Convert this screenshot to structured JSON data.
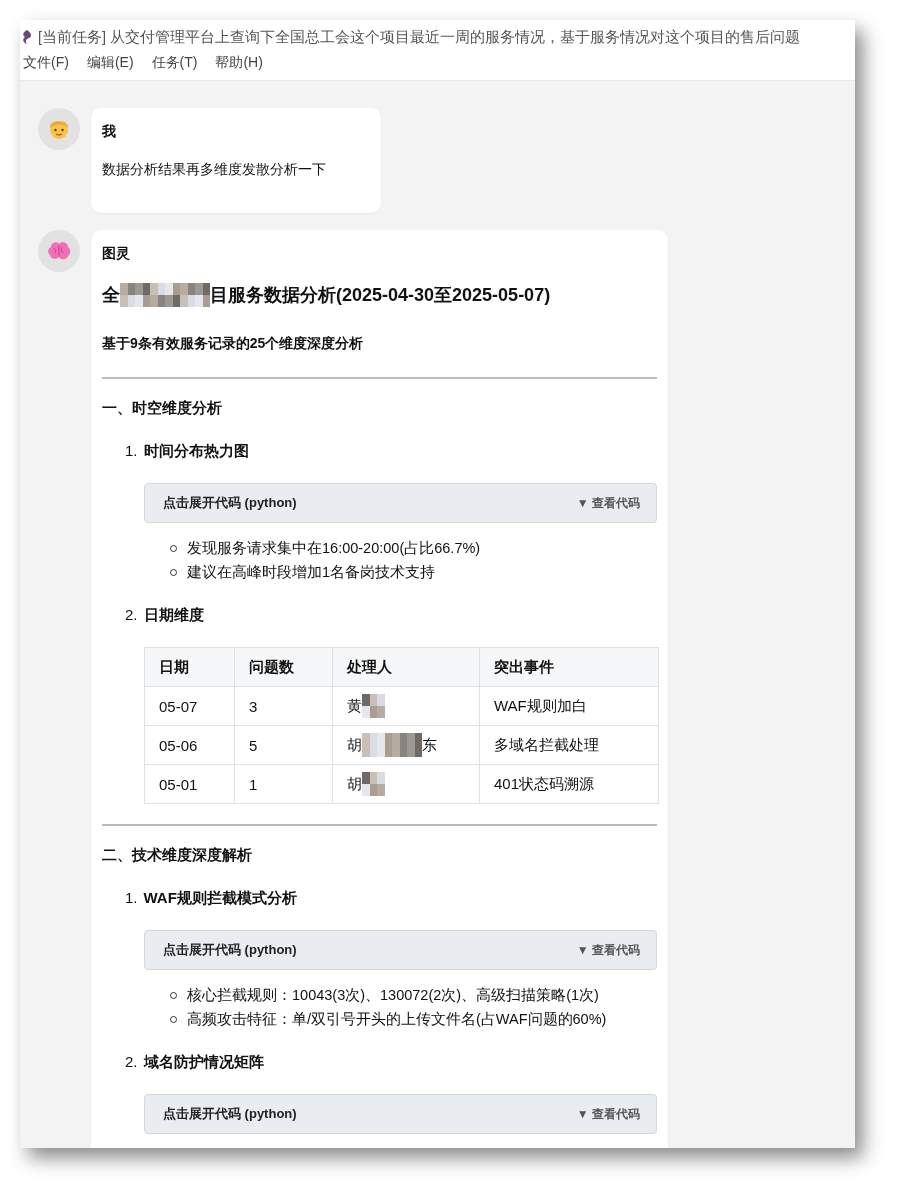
{
  "window": {
    "title": "[当前任务] 从交付管理平台上查询下全国总工会这个项目最近一周的服务情况，基于服务情况对这个项目的售后问题"
  },
  "menu": [
    "文件(F)",
    "编辑(E)",
    "任务(T)",
    "帮助(H)"
  ],
  "messages": [
    {
      "kind": "user",
      "sender": "我",
      "text": "数据分析结果再多维度发散分析一下"
    },
    {
      "kind": "assistant",
      "sender": "图灵",
      "blocks": [
        {
          "kind": "title",
          "segments": [
            {
              "kind": "text",
              "text": "全"
            },
            {
              "kind": "redacted_long"
            },
            {
              "kind": "text",
              "text": "目服务数据分析(2025-04-30至2025-05-07)"
            }
          ]
        },
        {
          "kind": "subtitle",
          "text": "基于9条有效服务记录的25个维度深度分析"
        },
        {
          "kind": "rule"
        },
        {
          "kind": "heading",
          "text": "一、时空维度分析"
        },
        {
          "kind": "item",
          "number": "1.",
          "text": "时间分布热力图"
        },
        {
          "kind": "code",
          "label": "点击展开代码 (python)",
          "toggle": "▼ 查看代码"
        },
        {
          "kind": "bullets",
          "items": [
            "发现服务请求集中在16:00-20:00(占比66.7%)",
            "建议在高峰时段增加1名备岗技术支持"
          ]
        },
        {
          "kind": "item",
          "number": "2.",
          "text": "日期维度"
        },
        {
          "kind": "table",
          "columns": [
            "日期",
            "问题数",
            "处理人",
            "突出事件"
          ],
          "rows": [
            [
              "05-07",
              "3",
              [
                {
                  "kind": "text",
                  "text": "黄"
                },
                {
                  "kind": "redacted_short"
                }
              ],
              "WAF规则加白"
            ],
            [
              "05-06",
              "5",
              [
                {
                  "kind": "text",
                  "text": "胡"
                },
                {
                  "kind": "redacted_medium"
                },
                {
                  "kind": "text",
                  "text": "东"
                }
              ],
              "多域名拦截处理"
            ],
            [
              "05-01",
              "1",
              [
                {
                  "kind": "text",
                  "text": "胡"
                },
                {
                  "kind": "redacted_short"
                }
              ],
              "401状态码溯源"
            ]
          ]
        },
        {
          "kind": "rule"
        },
        {
          "kind": "heading",
          "text": "二、技术维度深度解析"
        },
        {
          "kind": "item",
          "number": "1.",
          "text": "WAF规则拦截模式分析"
        },
        {
          "kind": "code",
          "label": "点击展开代码 (python)",
          "toggle": "▼ 查看代码"
        },
        {
          "kind": "bullets",
          "items": [
            "核心拦截规则：10043(3次)、130072(2次)、高级扫描策略(1次)",
            "高频攻击特征：单/双引号开头的上传文件名(占WAF问题的60%)"
          ]
        },
        {
          "kind": "item",
          "number": "2.",
          "text": "域名防护情况矩阵"
        },
        {
          "kind": "code",
          "label": "点击展开代码 (python)",
          "toggle": "▼ 查看代码"
        }
      ]
    }
  ]
}
